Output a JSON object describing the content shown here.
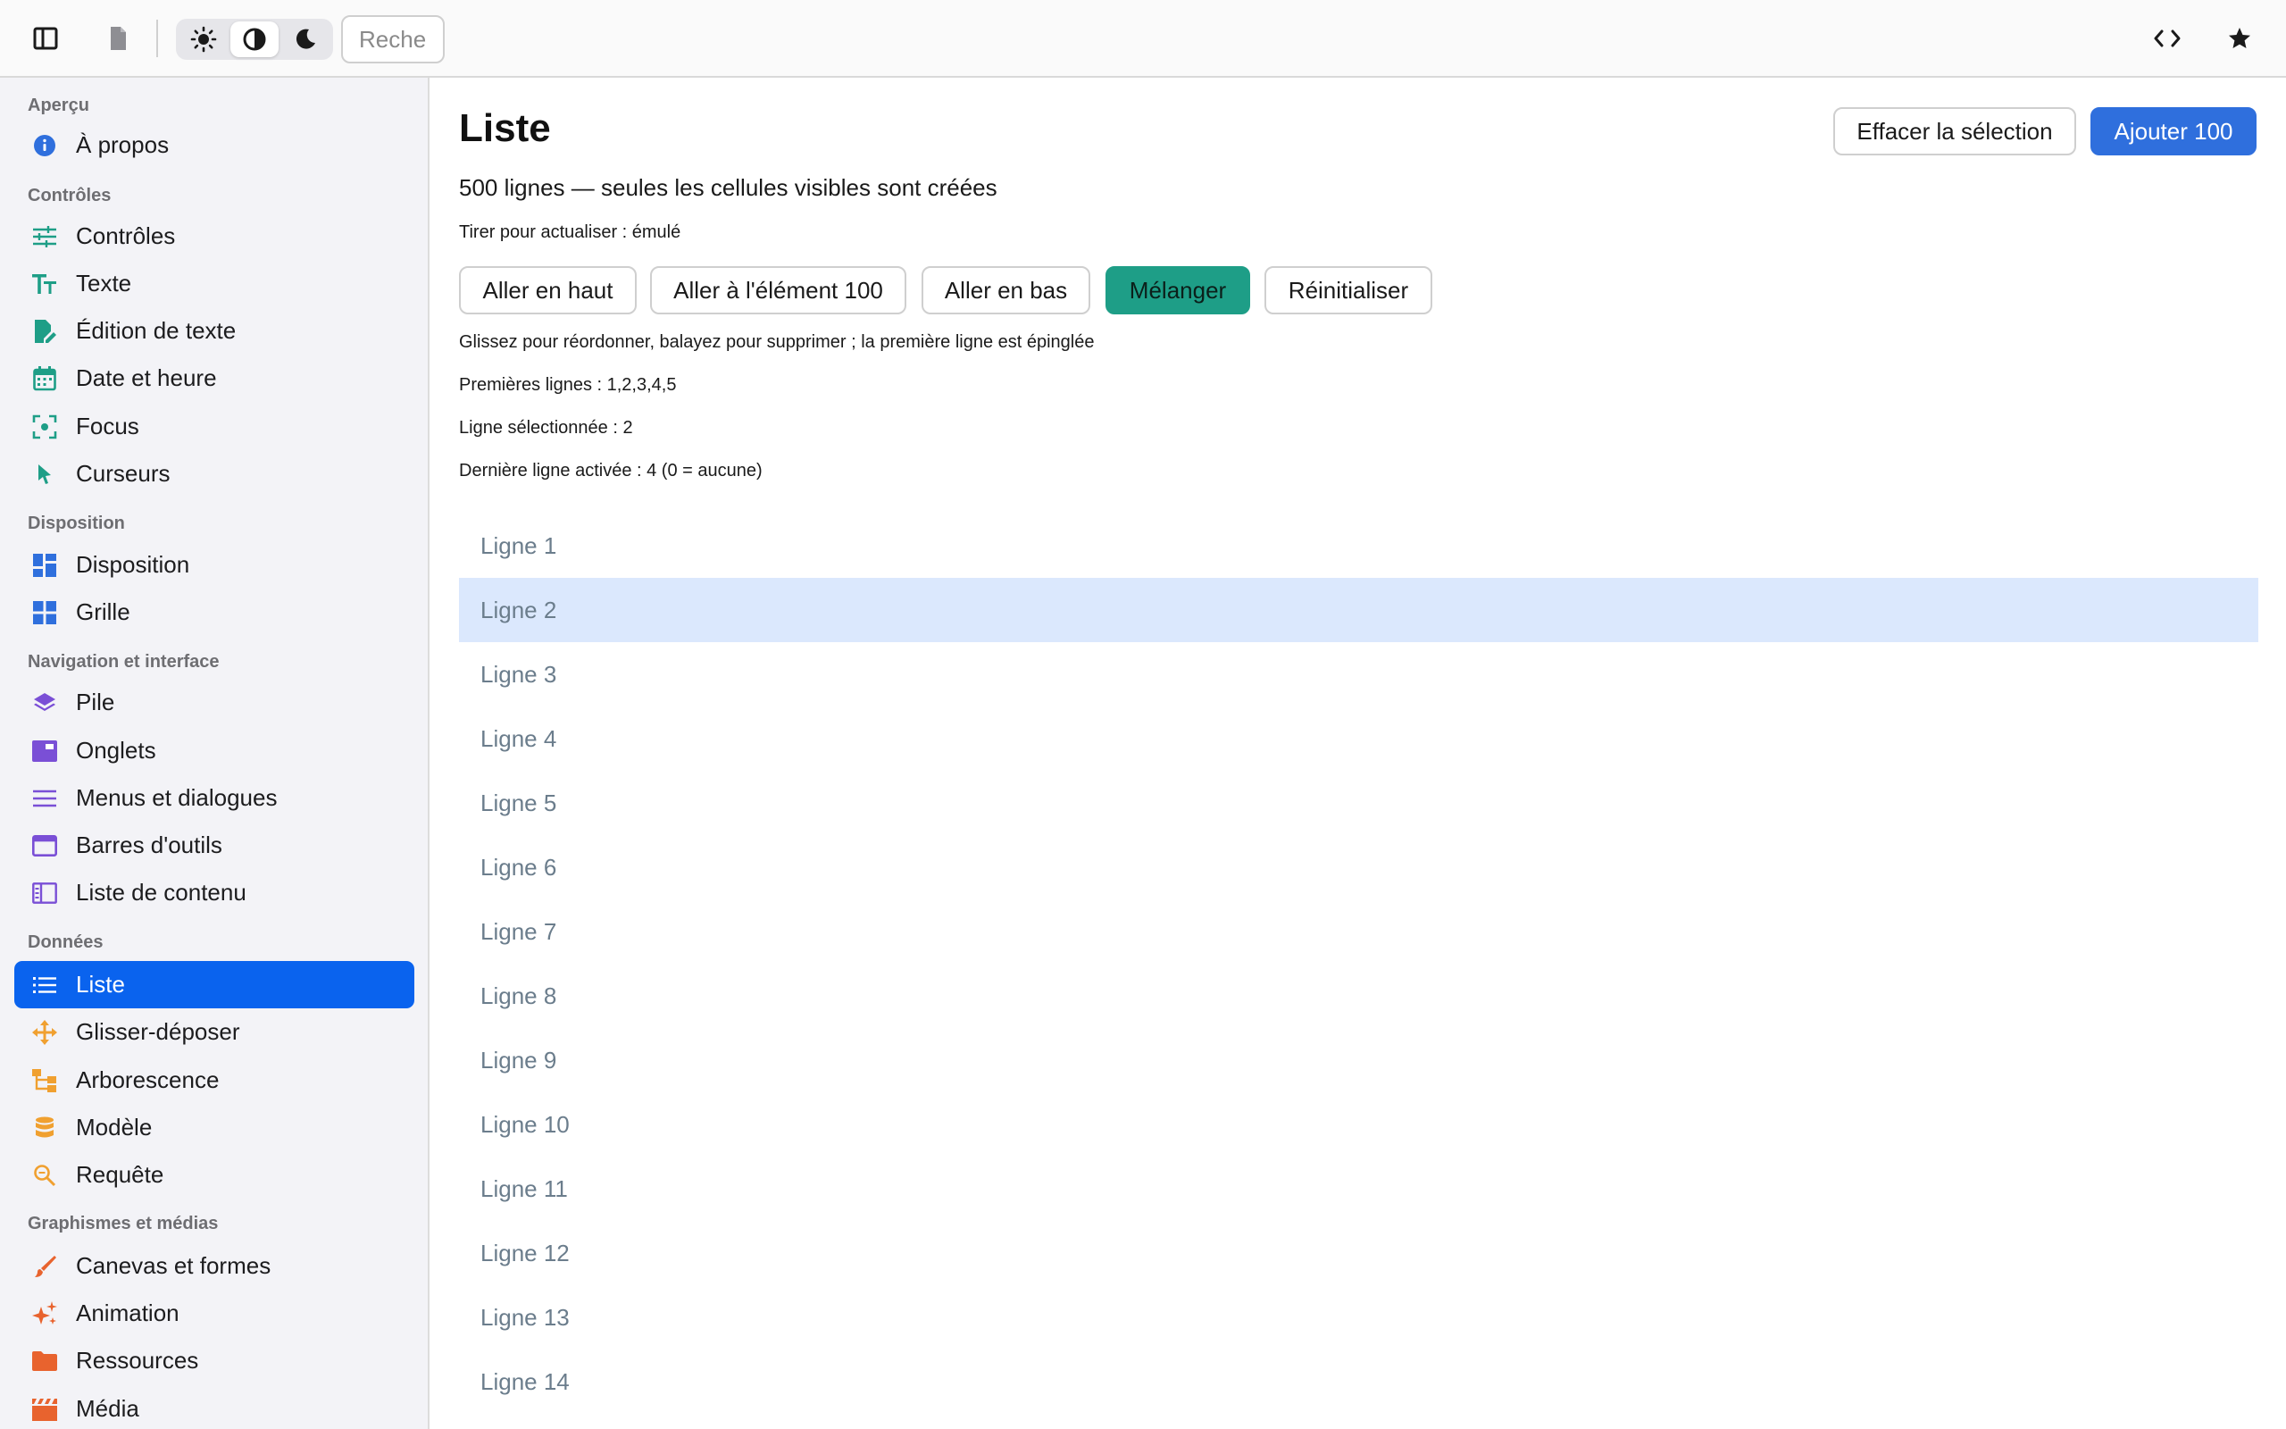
{
  "toolbar": {
    "search_placeholder": "Rechercher",
    "theme_options": [
      "light",
      "auto",
      "dark"
    ],
    "active_theme": "auto"
  },
  "sidebar": {
    "groups": [
      {
        "title": "Aperçu",
        "items": [
          {
            "label": "À propos",
            "icon": "info-icon",
            "color": "#2f6fdd"
          }
        ]
      },
      {
        "title": "Contrôles",
        "items": [
          {
            "label": "Contrôles",
            "icon": "sliders-icon",
            "color": "#1e9e87"
          },
          {
            "label": "Texte",
            "icon": "text-icon",
            "color": "#1e9e87"
          },
          {
            "label": "Édition de texte",
            "icon": "edit-document-icon",
            "color": "#1e9e87"
          },
          {
            "label": "Date et heure",
            "icon": "calendar-icon",
            "color": "#1e9e87"
          },
          {
            "label": "Focus",
            "icon": "focus-icon",
            "color": "#1e9e87"
          },
          {
            "label": "Curseurs",
            "icon": "cursor-icon",
            "color": "#1e9e87"
          }
        ]
      },
      {
        "title": "Disposition",
        "items": [
          {
            "label": "Disposition",
            "icon": "dashboard-icon",
            "color": "#2f6fdd"
          },
          {
            "label": "Grille",
            "icon": "grid-icon",
            "color": "#2f6fdd"
          }
        ]
      },
      {
        "title": "Navigation et interface",
        "items": [
          {
            "label": "Pile",
            "icon": "layers-icon",
            "color": "#7a4fd6"
          },
          {
            "label": "Onglets",
            "icon": "tabs-icon",
            "color": "#7a4fd6"
          },
          {
            "label": "Menus et dialogues",
            "icon": "menu-icon",
            "color": "#7a4fd6"
          },
          {
            "label": "Barres d'outils",
            "icon": "window-icon",
            "color": "#7a4fd6"
          },
          {
            "label": "Liste de contenu",
            "icon": "content-list-icon",
            "color": "#7a4fd6"
          }
        ]
      },
      {
        "title": "Données",
        "items": [
          {
            "label": "Liste",
            "icon": "list-icon",
            "color": "#ffffff"
          },
          {
            "label": "Glisser-déposer",
            "icon": "move-icon",
            "color": "#f0a030"
          },
          {
            "label": "Arborescence",
            "icon": "tree-icon",
            "color": "#f0a030"
          },
          {
            "label": "Modèle",
            "icon": "database-icon",
            "color": "#f0a030"
          },
          {
            "label": "Requête",
            "icon": "search-icon",
            "color": "#f0a030"
          }
        ]
      },
      {
        "title": "Graphismes et médias",
        "items": [
          {
            "label": "Canevas et formes",
            "icon": "brush-icon",
            "color": "#e8632e"
          },
          {
            "label": "Animation",
            "icon": "sparkle-icon",
            "color": "#e8632e"
          },
          {
            "label": "Ressources",
            "icon": "folder-icon",
            "color": "#e8632e"
          },
          {
            "label": "Média",
            "icon": "clapper-icon",
            "color": "#e8632e"
          }
        ]
      }
    ],
    "active_item": "Liste"
  },
  "main": {
    "title": "Liste",
    "clear_selection_label": "Effacer la sélection",
    "add_label": "Ajouter 100",
    "subtitle": "500 lignes — seules les cellules visibles sont créées",
    "pull_refresh": "Tirer pour actualiser : émulé",
    "actions": [
      "Aller en haut",
      "Aller à l'élément 100",
      "Aller en bas",
      "Mélanger",
      "Réinitialiser"
    ],
    "hint": "Glissez pour réordonner, balayez pour supprimer ; la première ligne est épinglée",
    "first_rows": "Premières lignes : 1,2,3,4,5",
    "selected_row": "Ligne sélectionnée : 2",
    "last_activated": "Dernière ligne activée : 4 (0 = aucune)",
    "rows": [
      "Ligne 1",
      "Ligne 2",
      "Ligne 3",
      "Ligne 4",
      "Ligne 5",
      "Ligne 6",
      "Ligne 7",
      "Ligne 8",
      "Ligne 9",
      "Ligne 10",
      "Ligne 11",
      "Ligne 12",
      "Ligne 13",
      "Ligne 14"
    ],
    "selected_index": 1
  },
  "colors": {
    "accent": "#0a63ee",
    "primary_button": "#2f6fdd",
    "shuffle_button": "#1e9e87",
    "selected_row": "#dbe8fd"
  }
}
